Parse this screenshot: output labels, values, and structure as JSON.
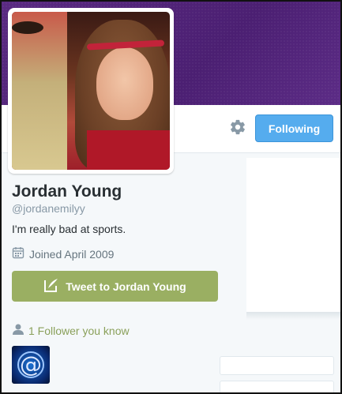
{
  "profile": {
    "name": "Jordan Young",
    "handle": "@jordanemilyy",
    "bio": "I'm really bad at sports.",
    "joined": "Joined April 2009"
  },
  "actions": {
    "following_label": "Following",
    "tweet_to_label": "Tweet to Jordan Young"
  },
  "social": {
    "followers_you_know": "1 Follower you know"
  },
  "icons": {
    "settings": "gear-icon",
    "calendar": "calendar-icon",
    "compose": "compose-icon",
    "person": "person-icon"
  },
  "colors": {
    "banner": "#4b1f72",
    "following_button": "#55acee",
    "tweet_to_button": "#9aaf62",
    "followers_link": "#8aa05a"
  }
}
